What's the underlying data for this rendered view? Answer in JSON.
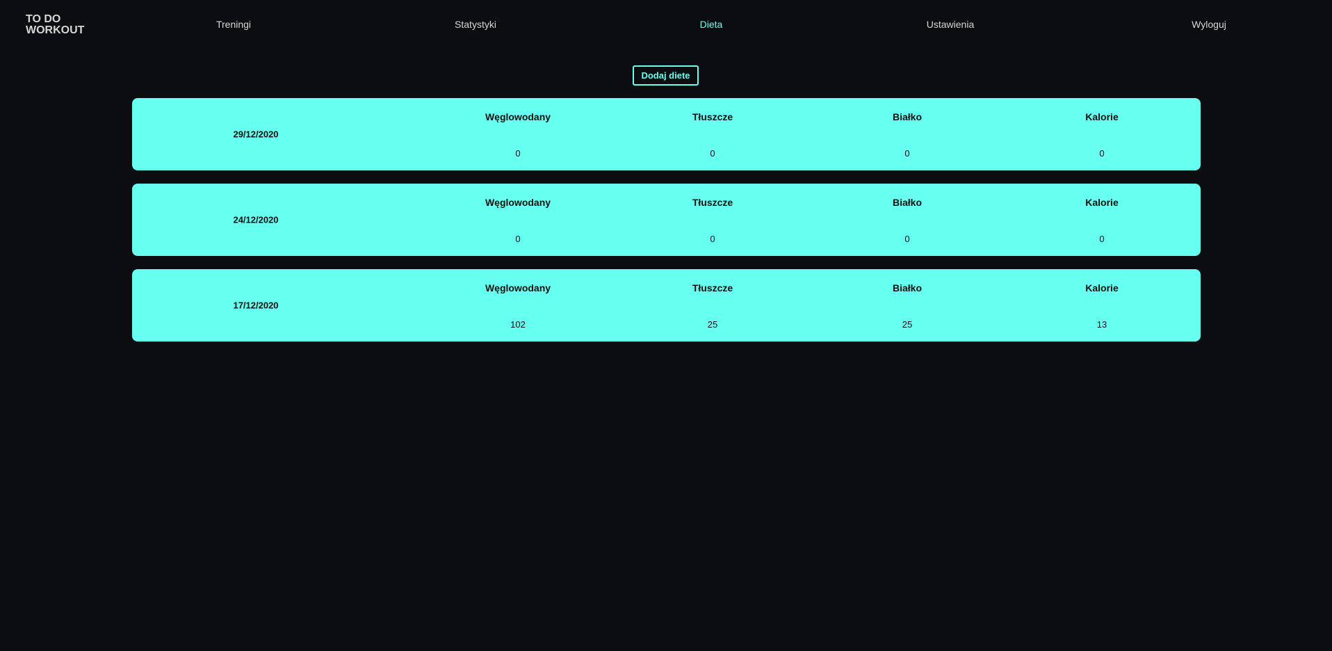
{
  "app": {
    "logo_line1": "TO DO",
    "logo_line2": "WORKOUT"
  },
  "nav": {
    "items": [
      {
        "label": "Treningi"
      },
      {
        "label": "Statystyki"
      },
      {
        "label": "Dieta",
        "active": true
      },
      {
        "label": "Ustawienia"
      },
      {
        "label": "Wyloguj"
      }
    ]
  },
  "actions": {
    "add_diet_label": "Dodaj diete"
  },
  "columns": [
    "Węglowodany",
    "Tłuszcze",
    "Białko",
    "Kalorie"
  ],
  "diets": [
    {
      "date": "29/12/2020",
      "values": [
        "0",
        "0",
        "0",
        "0"
      ]
    },
    {
      "date": "24/12/2020",
      "values": [
        "0",
        "0",
        "0",
        "0"
      ]
    },
    {
      "date": "17/12/2020",
      "values": [
        "102",
        "25",
        "25",
        "13"
      ]
    }
  ],
  "colors": {
    "background": "#0b0d11",
    "accent": "#66fff0",
    "nav_text": "#d6d6d6"
  }
}
